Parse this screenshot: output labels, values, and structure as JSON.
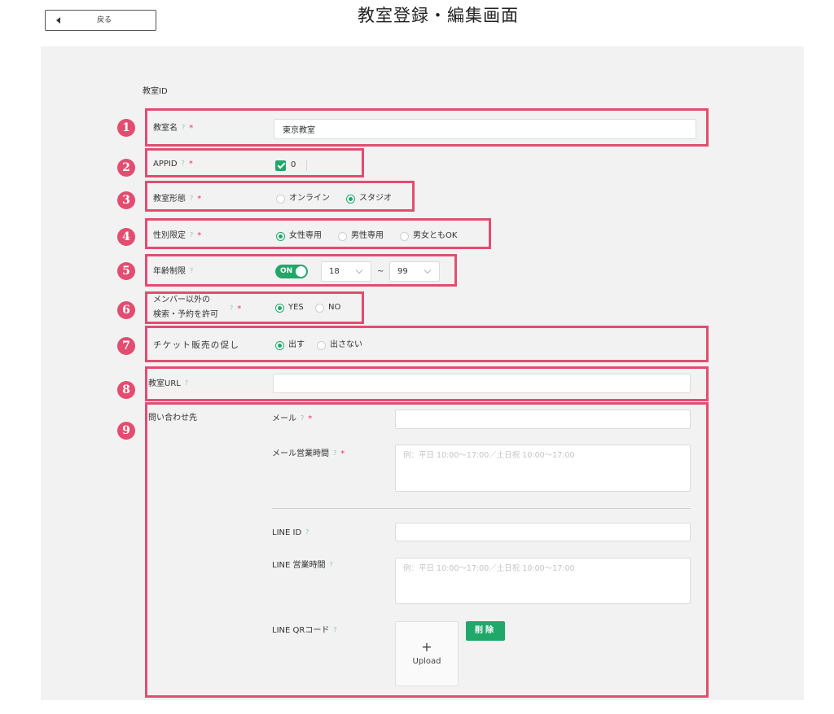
{
  "header": {
    "back_label": "戻る",
    "title": "教室登録・編集画面"
  },
  "icons": {
    "back": "caret-left-icon",
    "help": "question-icon",
    "select": "chevron-down-icon",
    "checkbox": "check-icon",
    "upload": "plus-icon"
  },
  "colors": {
    "highlight": "#e24d70",
    "accent": "#1fa86a",
    "required": "#e8384f",
    "help": "#86c7b6",
    "panel_bg": "#f2f2f2"
  },
  "help_mark": "?",
  "required_mark": "*",
  "annotations": [
    "1",
    "2",
    "3",
    "4",
    "5",
    "6",
    "7",
    "8",
    "9"
  ],
  "form": {
    "classroom_id": {
      "label": "教室ID"
    },
    "classroom_name": {
      "label": "教室名",
      "value": "東京教室"
    },
    "app_id": {
      "label": "APPID",
      "checked": true,
      "option_label": "0"
    },
    "classroom_type": {
      "label": "教室形態",
      "options": [
        {
          "label": "オンライン",
          "selected": false
        },
        {
          "label": "スタジオ",
          "selected": true
        }
      ]
    },
    "gender_limit": {
      "label": "性別限定",
      "options": [
        {
          "label": "女性専用",
          "selected": true
        },
        {
          "label": "男性専用",
          "selected": false
        },
        {
          "label": "男女ともOK",
          "selected": false
        }
      ]
    },
    "age_limit": {
      "label": "年齢制限",
      "enabled": true,
      "toggle_label": "ON",
      "min_age": "18",
      "separator": "~",
      "max_age": "99"
    },
    "non_member_access": {
      "label_line1": "メンバー以外の",
      "label_line2": "検索・予約を許可",
      "options": [
        {
          "label": "YES",
          "selected": true
        },
        {
          "label": "NO",
          "selected": false
        }
      ]
    },
    "ticket_promotion": {
      "label": "チケット販売の促し",
      "options": [
        {
          "label": "出す",
          "selected": true
        },
        {
          "label": "出さない",
          "selected": false
        }
      ]
    },
    "classroom_url": {
      "label": "教室URL"
    },
    "contact": {
      "label": "問い合わせ先",
      "email": {
        "label": "メール"
      },
      "email_hours": {
        "label": "メール営業時間",
        "placeholder": "例：平日 10:00〜17:00／土日祝 10:00〜17:00"
      },
      "line_id": {
        "label": "LINE ID"
      },
      "line_hours": {
        "label": "LINE 営業時間",
        "placeholder": "例：平日 10:00〜17:00／土日祝 10:00〜17:00"
      },
      "line_qr": {
        "label": "LINE QRコード",
        "upload_symbol": "+",
        "upload_label": "Upload",
        "delete_label": "削除"
      }
    }
  }
}
